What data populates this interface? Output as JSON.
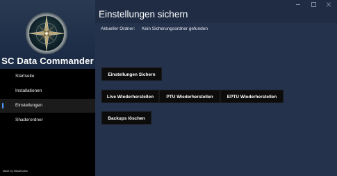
{
  "app": {
    "title": "SC Data Commander",
    "credit": "Made by MetaZirafon"
  },
  "sidebar": {
    "items": [
      {
        "label": "Startseite",
        "active": false
      },
      {
        "label": "Installationen",
        "active": false
      },
      {
        "label": "Einstellungen",
        "active": true
      },
      {
        "label": "Shaderordner",
        "active": false
      }
    ]
  },
  "main": {
    "title": "Einstellungen sichern",
    "folder_label": "Aktueller Ordner:",
    "folder_value": "Kein Sicherungsordner gefunden",
    "buttons": {
      "save": "Einstellungen Sichern",
      "restore_live": "Live Wiederherstellen",
      "restore_ptu": "PTU Wiederherstellen",
      "restore_eptu": "EPTU Wiederherstellen",
      "delete_backups": "Backups löschen"
    }
  },
  "colors": {
    "sidebar_bg": "#000000",
    "header_bg": "#1f2c44",
    "main_bg": "#24324c",
    "button_bg": "#0c0c0c",
    "accent": "#4aa0ff"
  },
  "icons": {
    "logo": "compass-star-logo",
    "window_controls": [
      "minimize-icon",
      "maximize-icon",
      "close-icon"
    ]
  }
}
